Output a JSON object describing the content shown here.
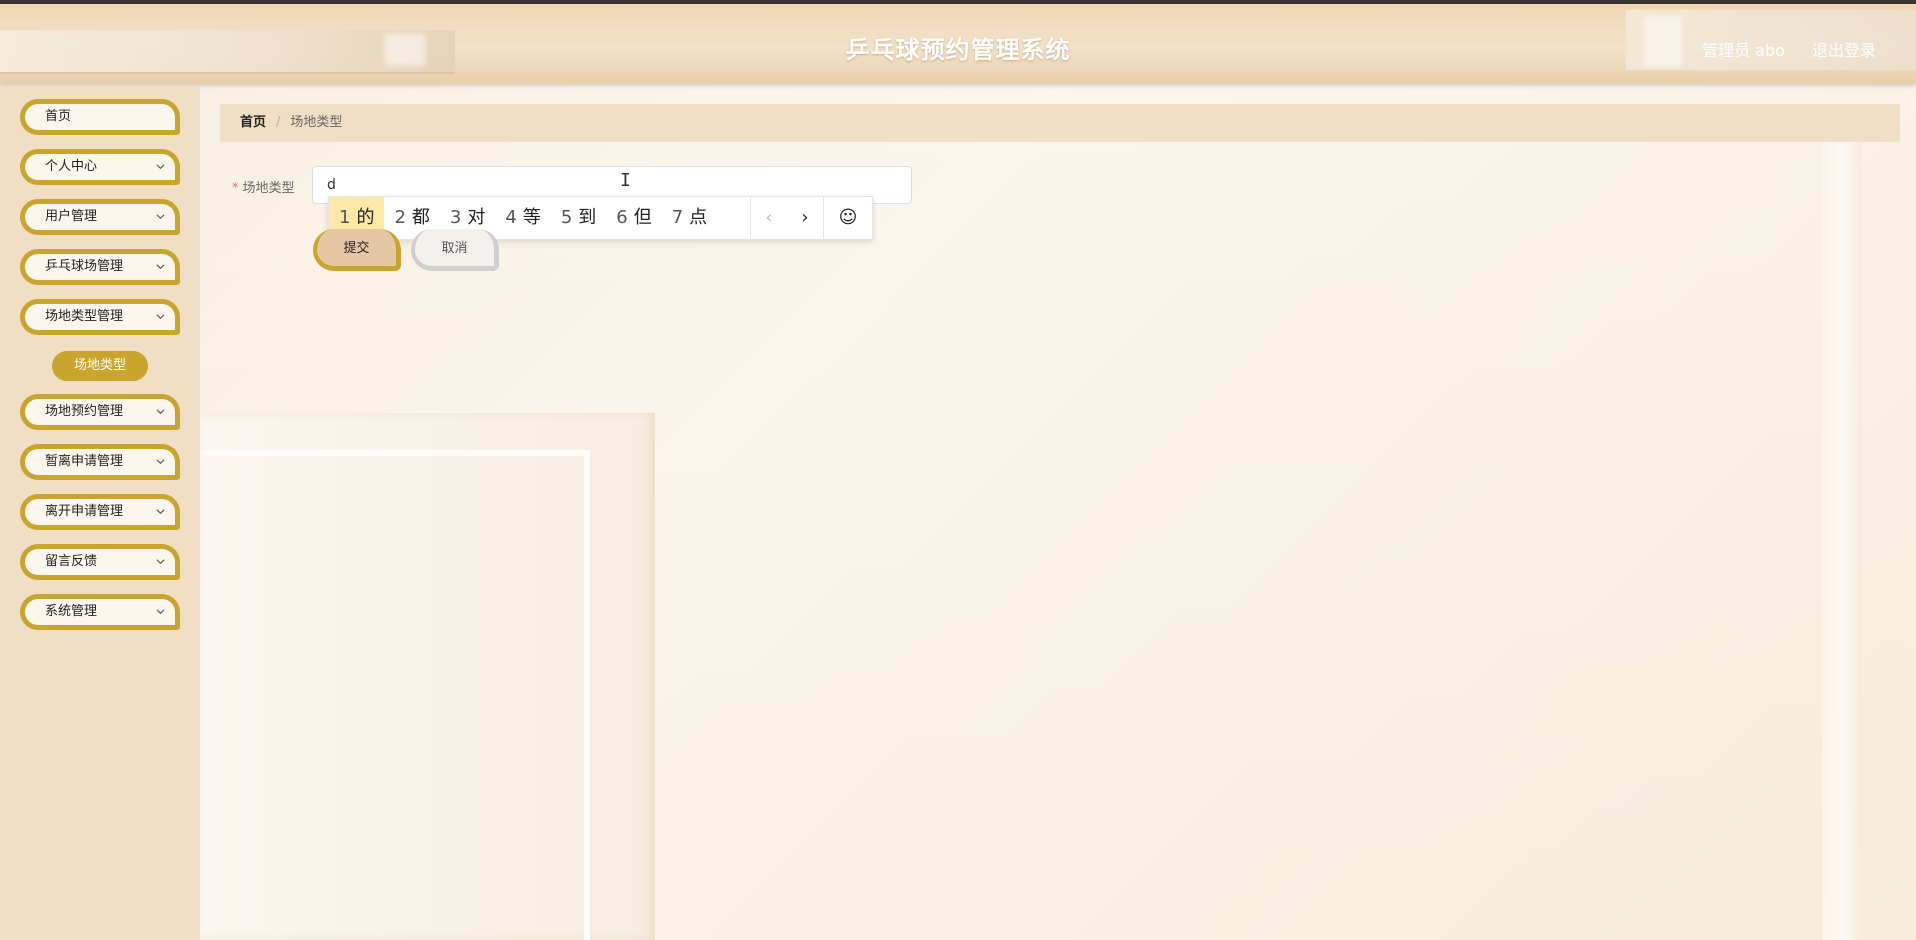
{
  "header": {
    "title": "乒乓球预约管理系统",
    "user_label": "管理员 abo",
    "logout_label": "退出登录"
  },
  "sidebar": {
    "items": [
      {
        "label": "首页",
        "has_arrow": false
      },
      {
        "label": "个人中心",
        "has_arrow": true
      },
      {
        "label": "用户管理",
        "has_arrow": true
      },
      {
        "label": "乒乓球场管理",
        "has_arrow": true
      },
      {
        "label": "场地类型管理",
        "has_arrow": true
      },
      {
        "label": "场地预约管理",
        "has_arrow": true
      },
      {
        "label": "暂离申请管理",
        "has_arrow": true
      },
      {
        "label": "离开申请管理",
        "has_arrow": true
      },
      {
        "label": "留言反馈",
        "has_arrow": true
      },
      {
        "label": "系统管理",
        "has_arrow": true
      }
    ],
    "active_sub": "场地类型"
  },
  "breadcrumb": {
    "home": "首页",
    "separator": "/",
    "current": "场地类型"
  },
  "form": {
    "field_label": "场地类型",
    "required_mark": "*",
    "field_value": "d",
    "submit_label": "提交",
    "cancel_label": "取消"
  },
  "ime": {
    "candidates": [
      {
        "num": "1",
        "text": "的"
      },
      {
        "num": "2",
        "text": "都"
      },
      {
        "num": "3",
        "text": "对"
      },
      {
        "num": "4",
        "text": "等"
      },
      {
        "num": "5",
        "text": "到"
      },
      {
        "num": "6",
        "text": "但"
      },
      {
        "num": "7",
        "text": "点"
      }
    ],
    "prev": "‹",
    "next": "›",
    "emoji": "☺"
  },
  "colors": {
    "accent": "#c9a52e",
    "sidebar_bg": "#f0dfc4",
    "ime_highlight": "#ffe9a8"
  }
}
